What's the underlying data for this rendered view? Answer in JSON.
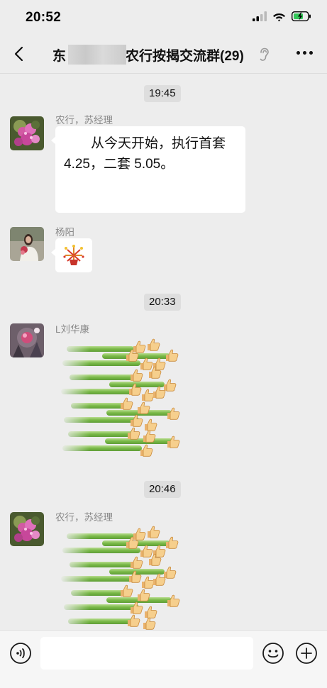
{
  "status_bar": {
    "time": "20:52"
  },
  "header": {
    "title": "东湖世纪 农行按揭交流群(29)",
    "title_prefix": "东",
    "title_suffix": "农行按揭交流群(29)",
    "back_icon": "chevron-left-icon",
    "mute_icon": "ear-icon",
    "more_icon": "more-dots-icon"
  },
  "messages": [
    {
      "type": "time",
      "text": "19:45"
    },
    {
      "type": "text",
      "sender": "农行，苏经理",
      "line1": "从今天开始，执行首套",
      "line2": "4.25，二套 5.05。"
    },
    {
      "type": "sticker",
      "sender": "杨阳",
      "sticker": "fireworks"
    },
    {
      "type": "time",
      "text": "20:33"
    },
    {
      "type": "sticker",
      "sender": "L刘华康",
      "sticker": "thumbs-up-sticker"
    },
    {
      "type": "time",
      "text": "20:46"
    },
    {
      "type": "sticker",
      "sender": "农行，苏经理",
      "sticker": "thumbs-up-sticker"
    }
  ],
  "input_bar": {
    "placeholder": "",
    "voice_icon": "voice-icon",
    "emoji_icon": "emoji-icon",
    "plus_icon": "plus-icon"
  },
  "colors": {
    "background": "#ededed",
    "bubble": "#ffffff",
    "timestamp_chip": "#dedede",
    "sender_name": "#888888",
    "battery_charge": "#34c759"
  }
}
